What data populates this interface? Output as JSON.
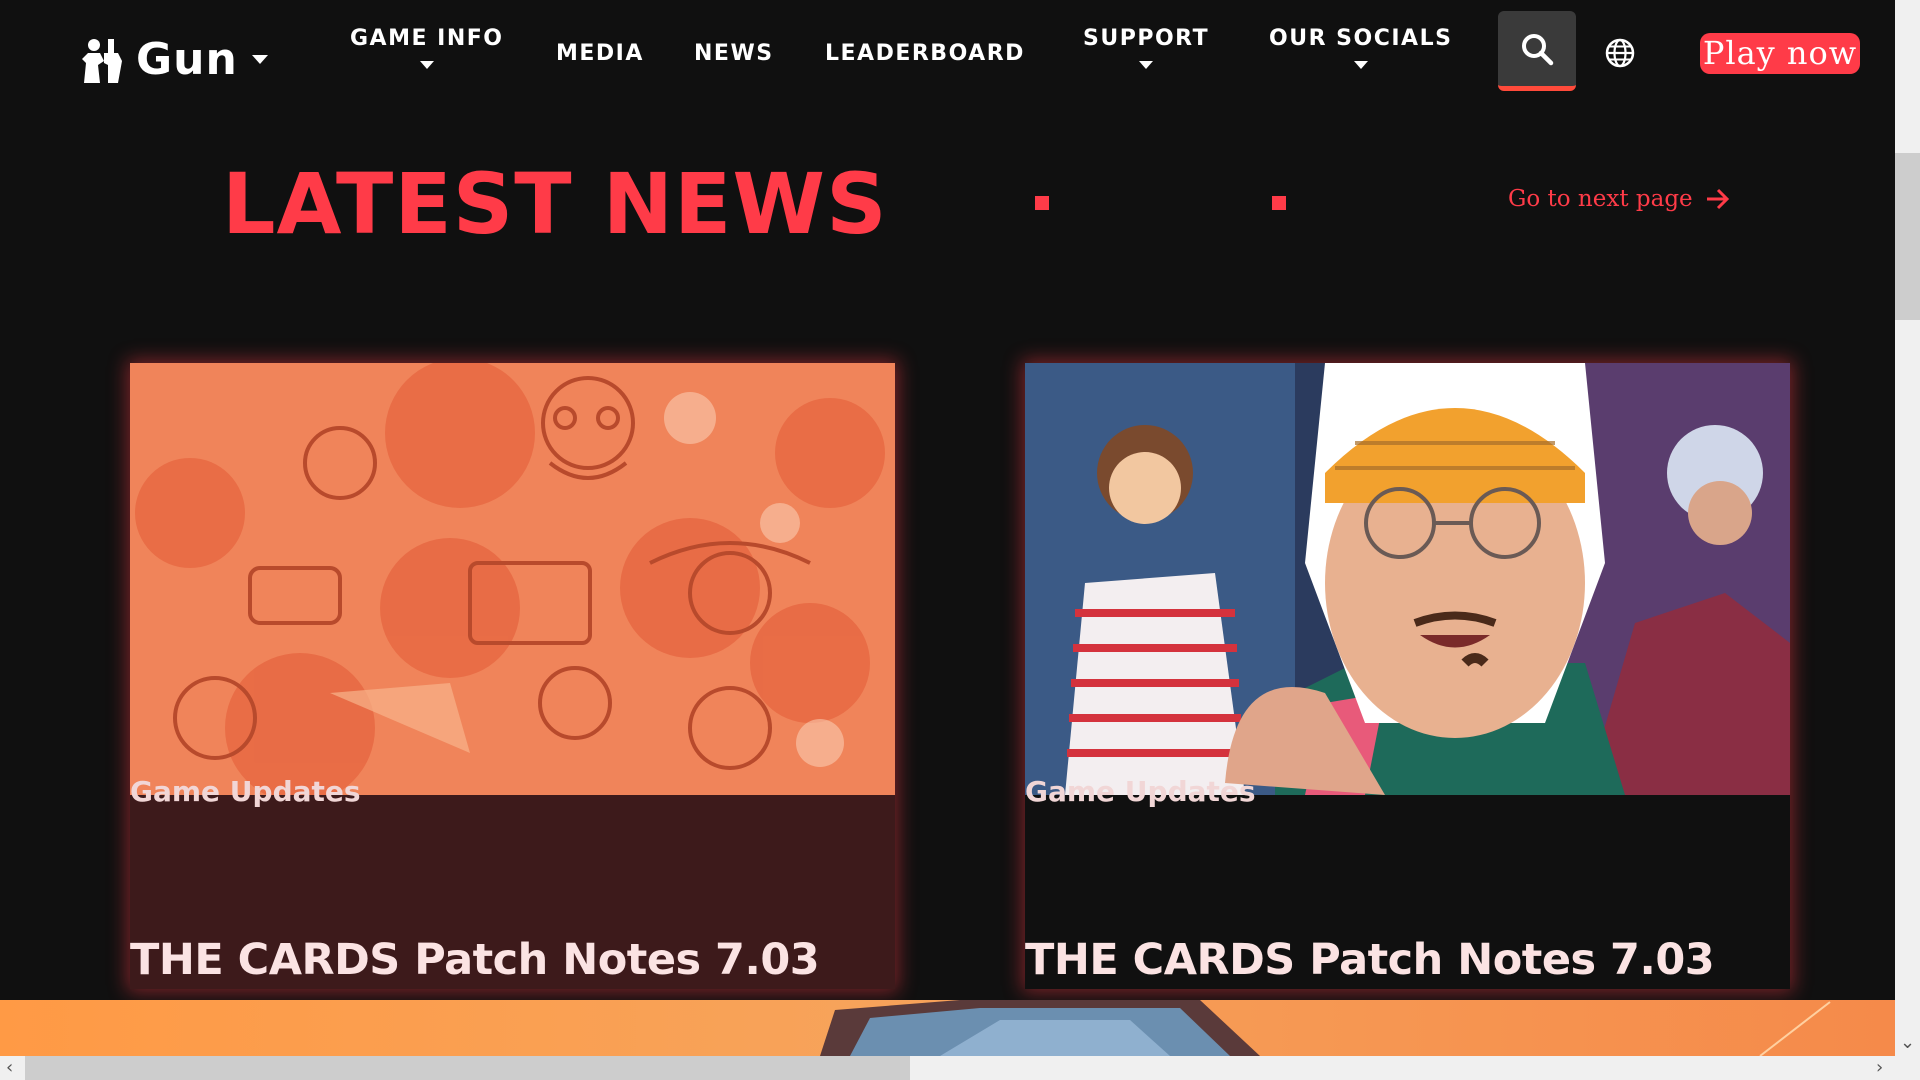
{
  "brand": {
    "name": "Gun"
  },
  "nav": {
    "items": [
      {
        "label": "GAME INFO",
        "has_dropdown": true
      },
      {
        "label": "MEDIA",
        "has_dropdown": false
      },
      {
        "label": "NEWS",
        "has_dropdown": false
      },
      {
        "label": "LEADERBOARD",
        "has_dropdown": false
      },
      {
        "label": "SUPPORT",
        "has_dropdown": true
      },
      {
        "label": "OUR SOCIALS",
        "has_dropdown": true
      }
    ],
    "search_icon": "search-icon",
    "language_icon": "globe-icon",
    "cta_label": "Play now"
  },
  "news": {
    "title": "LATEST NEWS",
    "next_link_label": "Go to next page",
    "cards": [
      {
        "category": "Game Updates",
        "title": "THE CARDS Patch Notes 7.03",
        "image": "orange-character-collage"
      },
      {
        "category": "Game Updates",
        "title": "THE CARDS Patch Notes 7.03",
        "image": "streamer-with-yellow-beanie"
      }
    ]
  },
  "colors": {
    "accent": "#ff3b48",
    "background": "#101010",
    "card1_body": "#3d1a1b",
    "card2_body": "#101010"
  }
}
